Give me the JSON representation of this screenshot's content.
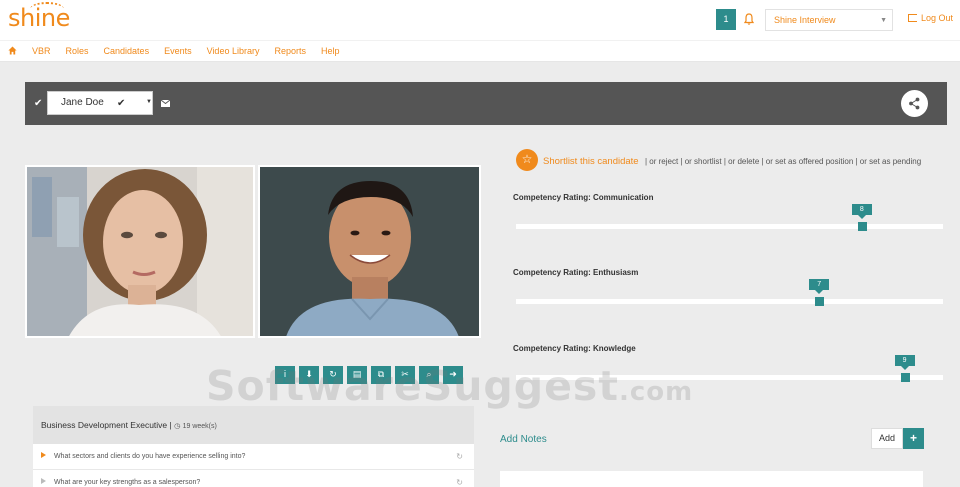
{
  "app": {
    "logo_text": "shine"
  },
  "header": {
    "notification_count": "1",
    "interview_select": "Shine Interview",
    "logout_label": "Log Out"
  },
  "nav": {
    "items": [
      "VBR",
      "Roles",
      "Candidates",
      "Events",
      "Video Library",
      "Reports",
      "Help"
    ]
  },
  "candidate": {
    "name": "Jane Doe"
  },
  "shortlist": {
    "label": "Shortlist this candidate",
    "options_text": "| or reject | or shortlist | or delete | or set as offered position | or set as pending"
  },
  "ratings": [
    {
      "label": "Competency Rating: Communication",
      "value": "8",
      "fraction": 0.81
    },
    {
      "label": "Competency Rating: Enthusiasm",
      "value": "7",
      "fraction": 0.71
    },
    {
      "label": "Competency Rating: Knowledge",
      "value": "9",
      "fraction": 0.91
    }
  ],
  "toolbar_icons": [
    "info-icon",
    "download-icon",
    "refresh-icon",
    "save-icon",
    "copy-icon",
    "cut-icon",
    "search-icon",
    "arrow-right-icon"
  ],
  "questions": {
    "role": "Business Development Executive",
    "duration": "19 week(s)",
    "items": [
      "What sectors and clients do you have experience selling into?",
      "What are your key strengths as a salesperson?"
    ]
  },
  "notes": {
    "title": "Add Notes",
    "add_label": "Add",
    "plus_label": "+"
  },
  "watermark": {
    "main": "SoftwareSuggest",
    "suffix": ".com"
  },
  "colors": {
    "accent": "#f08a1c",
    "teal": "#2d8c8c",
    "bar": "#555555"
  }
}
